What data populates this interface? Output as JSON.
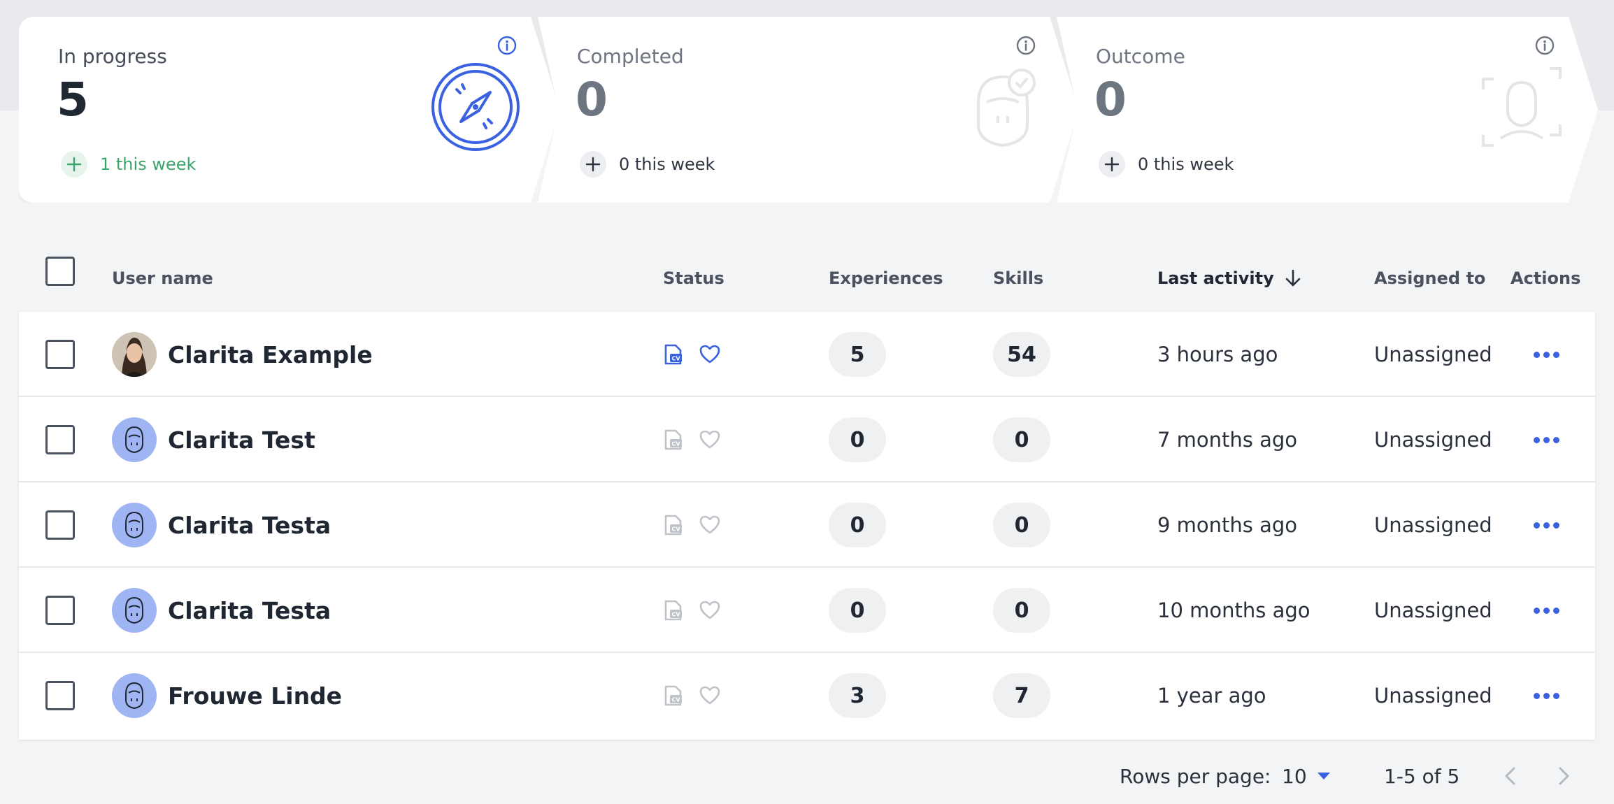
{
  "stats": [
    {
      "label": "In progress",
      "value": "5",
      "week": "1 this week"
    },
    {
      "label": "Completed",
      "value": "0",
      "week": "0 this week"
    },
    {
      "label": "Outcome",
      "value": "0",
      "week": "0 this week"
    }
  ],
  "colors": {
    "accent": "#3a61e0",
    "green": "#3aa56b",
    "avatar_bg": "#9fb4f2"
  },
  "table": {
    "columns": {
      "user_name": "User name",
      "status": "Status",
      "experiences": "Experiences",
      "skills": "Skills",
      "last_activity": "Last activity",
      "assigned_to": "Assigned to",
      "actions": "Actions"
    },
    "sorted_column": "last_activity",
    "sort_direction": "descending",
    "rows": [
      {
        "name": "Clarita Example",
        "status_active": true,
        "experiences": "5",
        "skills": "54",
        "last_activity": "3 hours ago",
        "assigned_to": "Unassigned",
        "avatar": "photo"
      },
      {
        "name": "Clarita Test",
        "status_active": false,
        "experiences": "0",
        "skills": "0",
        "last_activity": "7 months ago",
        "assigned_to": "Unassigned",
        "avatar": "placeholder-face-icon"
      },
      {
        "name": "Clarita Testa",
        "status_active": false,
        "experiences": "0",
        "skills": "0",
        "last_activity": "9 months ago",
        "assigned_to": "Unassigned",
        "avatar": "placeholder-face-icon"
      },
      {
        "name": "Clarita Testa",
        "status_active": false,
        "experiences": "0",
        "skills": "0",
        "last_activity": "10 months ago",
        "assigned_to": "Unassigned",
        "avatar": "placeholder-face-icon"
      },
      {
        "name": "Frouwe Linde",
        "status_active": false,
        "experiences": "3",
        "skills": "7",
        "last_activity": "1 year ago",
        "assigned_to": "Unassigned",
        "avatar": "placeholder-face-icon"
      }
    ]
  },
  "pagination": {
    "rows_per_page_label": "Rows per page:",
    "rows_per_page_value": "10",
    "range": "1-5 of 5"
  }
}
